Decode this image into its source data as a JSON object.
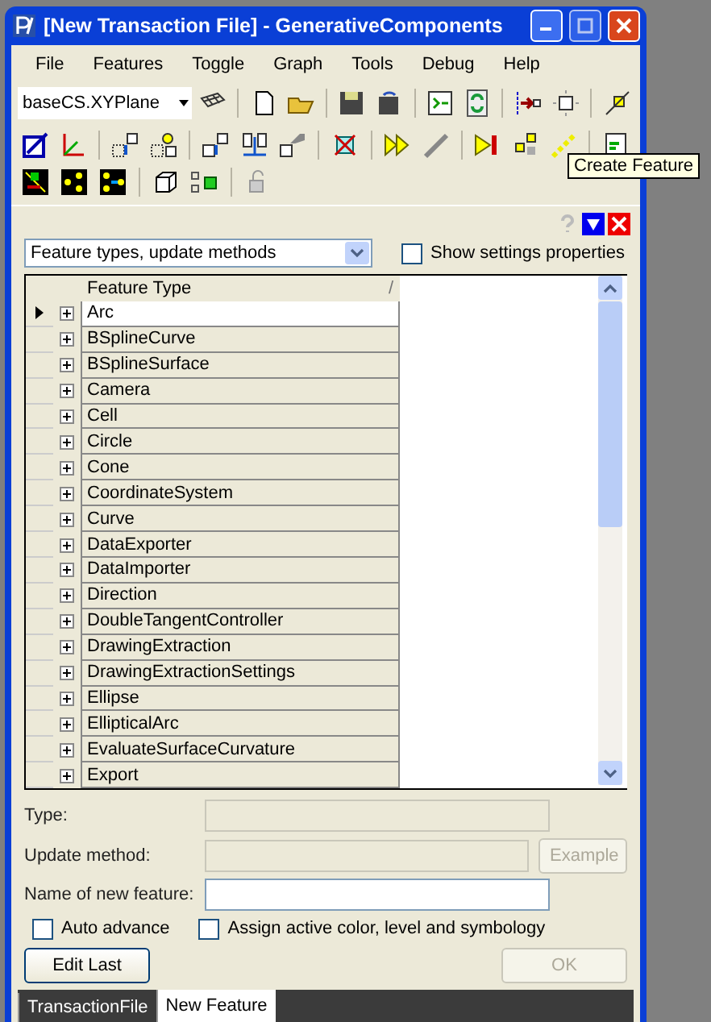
{
  "window": {
    "title": "[New Transaction File] - GenerativeComponents"
  },
  "menu": [
    "File",
    "Features",
    "Toggle",
    "Graph",
    "Tools",
    "Debug",
    "Help"
  ],
  "toolbar": {
    "plane_select": {
      "value": "baseCS.XYPlane"
    }
  },
  "tooltip": "Create Feature",
  "panel": {
    "view_select": {
      "value": "Feature types, update methods"
    },
    "show_settings": {
      "label": "Show settings properties",
      "checked": false
    },
    "table": {
      "columns": [
        "Feature Type"
      ],
      "sort_mark": "/",
      "rows": [
        {
          "name": "Arc",
          "selected": true
        },
        {
          "name": "BSplineCurve",
          "selected": false
        },
        {
          "name": "BSplineSurface",
          "selected": false
        },
        {
          "name": "Camera",
          "selected": false
        },
        {
          "name": "Cell",
          "selected": false
        },
        {
          "name": "Circle",
          "selected": false
        },
        {
          "name": "Cone",
          "selected": false
        },
        {
          "name": "CoordinateSystem",
          "selected": false
        },
        {
          "name": "Curve",
          "selected": false
        },
        {
          "name": "DataExporter",
          "selected": false
        },
        {
          "name": "DataImporter",
          "selected": false
        },
        {
          "name": "Direction",
          "selected": false
        },
        {
          "name": "DoubleTangentController",
          "selected": false
        },
        {
          "name": "DrawingExtraction",
          "selected": false
        },
        {
          "name": "DrawingExtractionSettings",
          "selected": false
        },
        {
          "name": "Ellipse",
          "selected": false
        },
        {
          "name": "EllipticalArc",
          "selected": false
        },
        {
          "name": "EvaluateSurfaceCurvature",
          "selected": false
        },
        {
          "name": "Export",
          "selected": false
        }
      ]
    },
    "type_label": "Type:",
    "update_label": "Update method:",
    "example_button": {
      "label": "Example",
      "disabled": true
    },
    "name_label": "Name of new feature:",
    "auto_advance": {
      "label": "Auto advance",
      "checked": false
    },
    "assign_active": {
      "label": "Assign active color, level and symbology",
      "checked": false
    },
    "edit_last_button": {
      "label": "Edit Last",
      "disabled": false
    },
    "ok_button": {
      "label": "OK",
      "disabled": true
    }
  },
  "bottom_tabs": [
    {
      "label": "TransactionFile",
      "selected": false
    },
    {
      "label": "New Feature",
      "selected": true
    }
  ]
}
